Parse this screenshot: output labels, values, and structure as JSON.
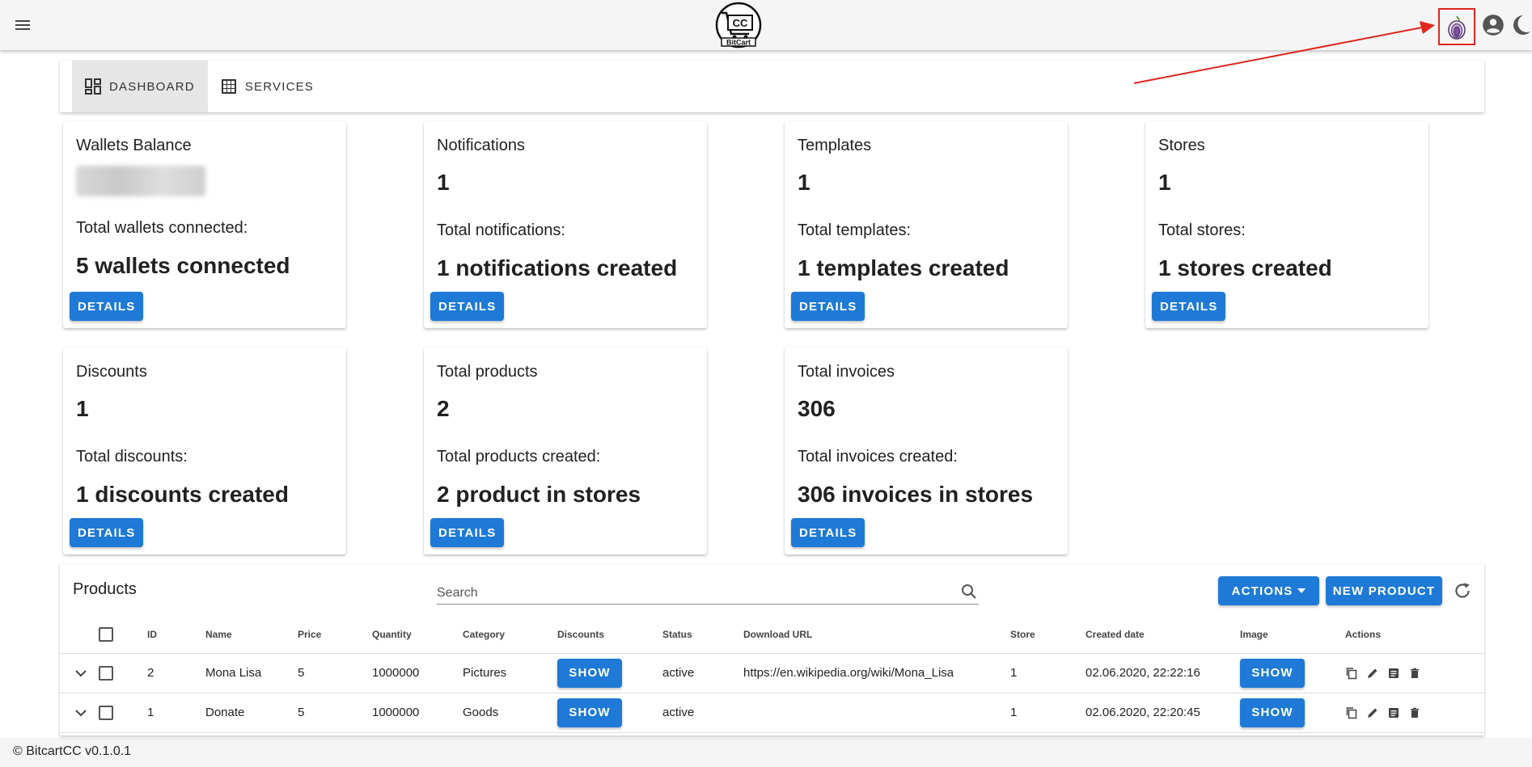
{
  "header": {
    "menu_icon": "menu-icon",
    "logo_text_top": "CC",
    "logo_text_bottom": "BitCart",
    "tor_icon": "tor-onion-icon",
    "account_icon": "account-circle-icon",
    "theme_icon": "moon-icon",
    "accent_colors": {
      "appbar": "#f5f5f5",
      "highlight_box": "#e0261e",
      "arrow": "#e0261e"
    }
  },
  "tabs": [
    {
      "label": "DASHBOARD",
      "icon": "dashboard-icon",
      "active": true
    },
    {
      "label": "SERVICES",
      "icon": "grid-icon",
      "active": false
    }
  ],
  "cards": {
    "wallets": {
      "title": "Wallets Balance",
      "value": "",
      "sub": "Total wallets connected:",
      "big": "5 wallets connected",
      "button": "DETAILS"
    },
    "notifications": {
      "title": "Notifications",
      "value": "1",
      "sub": "Total notifications:",
      "big": "1 notifications created",
      "button": "DETAILS"
    },
    "templates": {
      "title": "Templates",
      "value": "1",
      "sub": "Total templates:",
      "big": "1 templates created",
      "button": "DETAILS"
    },
    "stores": {
      "title": "Stores",
      "value": "1",
      "sub": "Total stores:",
      "big": "1 stores created",
      "button": "DETAILS"
    },
    "discounts": {
      "title": "Discounts",
      "value": "1",
      "sub": "Total discounts:",
      "big": "1 discounts created",
      "button": "DETAILS"
    },
    "products": {
      "title": "Total products",
      "value": "2",
      "sub": "Total products created:",
      "big": "2 product in stores",
      "button": "DETAILS"
    },
    "invoices": {
      "title": "Total invoices",
      "value": "306",
      "sub": "Total invoices created:",
      "big": "306 invoices in stores",
      "button": "DETAILS"
    }
  },
  "products_table": {
    "title": "Products",
    "search_placeholder": "Search",
    "actions_label": "ACTIONS",
    "new_label": "NEW PRODUCT",
    "columns": {
      "id": "ID",
      "name": "Name",
      "price": "Price",
      "quantity": "Quantity",
      "category": "Category",
      "discounts": "Discounts",
      "status": "Status",
      "download_url": "Download URL",
      "store": "Store",
      "created": "Created date",
      "image": "Image",
      "actions": "Actions"
    },
    "rows": [
      {
        "id": "2",
        "name": "Mona Lisa",
        "price": "5",
        "quantity": "1000000",
        "category": "Pictures",
        "discounts_btn": "SHOW",
        "status": "active",
        "download_url": "https://en.wikipedia.org/wiki/Mona_Lisa",
        "store": "1",
        "created": "02.06.2020, 22:22:16",
        "image_btn": "SHOW"
      },
      {
        "id": "1",
        "name": "Donate",
        "price": "5",
        "quantity": "1000000",
        "category": "Goods",
        "discounts_btn": "SHOW",
        "status": "active",
        "download_url": "",
        "store": "1",
        "created": "02.06.2020, 22:20:45",
        "image_btn": "SHOW"
      }
    ]
  },
  "footer": {
    "text": "© BitcartCC v0.1.0.1"
  }
}
